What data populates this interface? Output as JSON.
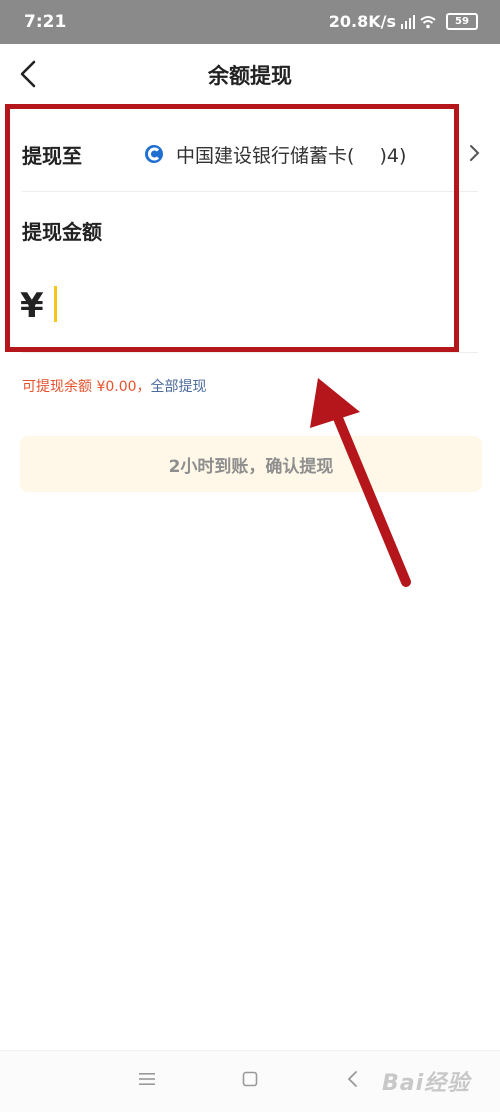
{
  "status_bar": {
    "time": "7:21",
    "network_speed": "20.8K/s",
    "battery": "59",
    "icons": [
      "hd-signal-icon",
      "wifi-icon",
      "battery-icon"
    ]
  },
  "nav": {
    "title": "余额提现",
    "back_icon": "chevron-left-icon"
  },
  "withdraw_to": {
    "label": "提现至",
    "bank_icon": "ccb-bank-logo-icon",
    "bank_name": "中国建设银行储蓄卡(　 )4)",
    "chevron_icon": "chevron-right-icon"
  },
  "amount": {
    "label": "提现金额",
    "currency_symbol": "¥",
    "value": ""
  },
  "balance": {
    "text": "可提现余额 ¥0.00，",
    "withdraw_all": "全部提现"
  },
  "confirm_button": "2小时到账，确认提现",
  "annotation": {
    "highlight_color": "#b5161b"
  },
  "system_nav": {
    "icons": [
      "menu-icon",
      "home-icon",
      "back-icon"
    ]
  },
  "watermark": "Bai经验"
}
